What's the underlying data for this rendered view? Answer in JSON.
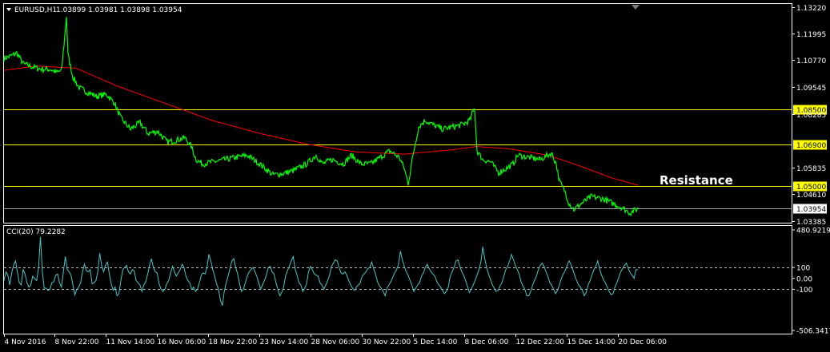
{
  "header": {
    "symbol": "EURUSD,H1",
    "ohlc": "1.03899 1.03981 1.03898 1.03954"
  },
  "colors": {
    "background": "#000000",
    "price": "#00ff00",
    "ma": "#ff0000",
    "level": "#ffff00",
    "bid": "#9aa0a6",
    "cci": "#49c6c6",
    "axis": "#ffffff"
  },
  "resistance_label": "Resistance",
  "indicator_label": "CCI(20) 79.2282",
  "chart_data": [
    {
      "type": "line",
      "title": "EURUSD,H1",
      "ylim": [
        1.033,
        1.1335
      ],
      "y_ticks": [
        "1.13220",
        "1.11995",
        "1.10770",
        "1.09545",
        "1.08285",
        "1.05835",
        "1.04610",
        "1.03385"
      ],
      "x_ticks": [
        "4 Nov 2016",
        "8 Nov 22:00",
        "11 Nov 14:00",
        "16 Nov 06:00",
        "18 Nov 22:00",
        "23 Nov 14:00",
        "28 Nov 06:00",
        "30 Nov 22:00",
        "5 Dec 14:00",
        "8 Dec 06:00",
        "12 Dec 22:00",
        "15 Dec 14:00",
        "20 Dec 06:00"
      ],
      "price_anchors": [
        [
          0,
          1.1085
        ],
        [
          8,
          1.1095
        ],
        [
          16,
          1.111
        ],
        [
          24,
          1.106
        ],
        [
          36,
          1.1045
        ],
        [
          48,
          1.1035
        ],
        [
          58,
          1.1035
        ],
        [
          66,
          1.102
        ],
        [
          72,
          1.103
        ],
        [
          75,
          1.115
        ],
        [
          78,
          1.128
        ],
        [
          80,
          1.11
        ],
        [
          86,
          1.1
        ],
        [
          94,
          1.095
        ],
        [
          104,
          1.093
        ],
        [
          116,
          1.091
        ],
        [
          128,
          1.092
        ],
        [
          138,
          1.088
        ],
        [
          146,
          1.081
        ],
        [
          158,
          1.076
        ],
        [
          170,
          1.079
        ],
        [
          180,
          1.074
        ],
        [
          192,
          1.075
        ],
        [
          204,
          1.07
        ],
        [
          216,
          1.071
        ],
        [
          226,
          1.072
        ],
        [
          234,
          1.068
        ],
        [
          240,
          1.062
        ],
        [
          248,
          1.06
        ],
        [
          262,
          1.061
        ],
        [
          276,
          1.062
        ],
        [
          290,
          1.063
        ],
        [
          304,
          1.064
        ],
        [
          316,
          1.061
        ],
        [
          326,
          1.058
        ],
        [
          336,
          1.055
        ],
        [
          348,
          1.0555
        ],
        [
          362,
          1.057
        ],
        [
          378,
          1.06
        ],
        [
          390,
          1.064
        ],
        [
          398,
          1.06
        ],
        [
          410,
          1.062
        ],
        [
          424,
          1.06
        ],
        [
          434,
          1.064
        ],
        [
          446,
          1.06
        ],
        [
          458,
          1.06
        ],
        [
          470,
          1.063
        ],
        [
          482,
          1.066
        ],
        [
          494,
          1.063
        ],
        [
          500,
          1.058
        ],
        [
          505,
          1.051
        ],
        [
          512,
          1.066
        ],
        [
          518,
          1.077
        ],
        [
          526,
          1.08
        ],
        [
          536,
          1.078
        ],
        [
          548,
          1.076
        ],
        [
          560,
          1.077
        ],
        [
          572,
          1.078
        ],
        [
          582,
          1.08
        ],
        [
          588,
          1.086
        ],
        [
          591,
          1.066
        ],
        [
          598,
          1.062
        ],
        [
          608,
          1.061
        ],
        [
          618,
          1.056
        ],
        [
          628,
          1.058
        ],
        [
          636,
          1.06
        ],
        [
          642,
          1.064
        ],
        [
          656,
          1.063
        ],
        [
          670,
          1.062
        ],
        [
          684,
          1.065
        ],
        [
          690,
          1.06
        ],
        [
          694,
          1.052
        ],
        [
          700,
          1.048
        ],
        [
          706,
          1.042
        ],
        [
          712,
          1.039
        ],
        [
          722,
          1.042
        ],
        [
          734,
          1.045
        ],
        [
          748,
          1.044
        ],
        [
          760,
          1.042
        ],
        [
          772,
          1.04
        ],
        [
          782,
          1.0375
        ],
        [
          792,
          1.0395
        ]
      ],
      "ma_anchors": [
        [
          0,
          1.103
        ],
        [
          40,
          1.105
        ],
        [
          90,
          1.104
        ],
        [
          140,
          1.096
        ],
        [
          200,
          1.088
        ],
        [
          260,
          1.08
        ],
        [
          320,
          1.074
        ],
        [
          380,
          1.069
        ],
        [
          440,
          1.0655
        ],
        [
          500,
          1.0645
        ],
        [
          560,
          1.0665
        ],
        [
          590,
          1.068
        ],
        [
          630,
          1.067
        ],
        [
          680,
          1.064
        ],
        [
          720,
          1.059
        ],
        [
          760,
          1.0535
        ],
        [
          792,
          1.0502
        ]
      ],
      "levels": [
        1.085,
        1.069,
        1.05
      ],
      "level_labels": [
        "1.08500",
        "1.06900",
        "1.05000"
      ],
      "bid": 1.03954,
      "bid_label": "1.03954"
    },
    {
      "type": "line",
      "title": "CCI(20) 79.2282",
      "ylim": [
        -506.3417,
        480.9219
      ],
      "y_ticks": [
        "480.9219",
        "100",
        "0.00",
        "-100",
        "-506.3417"
      ],
      "levels": [
        100,
        -100
      ],
      "cci_series": [
        -20,
        60,
        30,
        -60,
        50,
        120,
        160,
        60,
        -40,
        -60,
        80,
        40,
        -40,
        -80,
        -60,
        20,
        0,
        -20,
        90,
        380,
        60,
        -90,
        -90,
        -110,
        -100,
        -40,
        -30,
        30,
        40,
        -40,
        -80,
        60,
        200,
        80,
        60,
        30,
        -60,
        -150,
        -100,
        -80,
        -40,
        60,
        130,
        70,
        60,
        80,
        -50,
        -40,
        -20,
        60,
        230,
        120,
        60,
        120,
        150,
        40,
        -50,
        -110,
        -80,
        -160,
        -140,
        -20,
        80,
        100,
        120,
        60,
        40,
        80,
        70,
        -20,
        -40,
        -60,
        -120,
        -60,
        -30,
        40,
        120,
        180,
        100,
        60,
        50,
        -50,
        -100,
        -120,
        -100,
        -50,
        -20,
        50,
        110,
        60,
        20,
        50,
        80,
        130,
        100,
        20,
        -20,
        -40,
        -100,
        -80,
        -120,
        -100,
        -40,
        30,
        50,
        40,
        100,
        220,
        160,
        80,
        20,
        -50,
        -100,
        -200,
        -250,
        -120,
        -40,
        20,
        90,
        160,
        180,
        100,
        40,
        -50,
        -120,
        -100,
        -40,
        20,
        60,
        80,
        100,
        60,
        20,
        -40,
        -100,
        -60,
        -20,
        30,
        100,
        110,
        60,
        40,
        -40,
        -100,
        -160,
        -130,
        -80,
        20,
        70,
        110,
        160,
        200,
        90,
        30,
        -40,
        -60,
        -120,
        -90,
        -50,
        60,
        110,
        80,
        40,
        30,
        20,
        -40,
        -60,
        -100,
        -60,
        -20,
        30,
        110,
        140,
        170,
        160,
        100,
        50,
        40,
        60,
        30,
        -20,
        -60,
        -90,
        -110,
        -80,
        -60,
        -40,
        20,
        40,
        60,
        90,
        100,
        150,
        90,
        40,
        -30,
        -70,
        -90,
        -120,
        -160,
        -90,
        -60,
        -30,
        10,
        50,
        80,
        130,
        250,
        170,
        110,
        60,
        30,
        -20,
        -60,
        -120,
        -90,
        -60,
        -40,
        20,
        50,
        100,
        130,
        90,
        60,
        40,
        20,
        -30,
        -60,
        -80,
        -110,
        -140,
        -120,
        -80,
        20,
        60,
        100,
        160,
        170,
        110,
        60,
        30,
        -20,
        -70,
        -130,
        -100,
        -60,
        -20,
        30,
        80,
        150,
        290,
        180,
        100,
        40,
        -10,
        -60,
        -90,
        -120,
        -110,
        -70,
        -40,
        20,
        80,
        110,
        160,
        220,
        170,
        120,
        80,
        40,
        -30,
        -70,
        -100,
        -160,
        -160,
        -120,
        -60,
        -20,
        20,
        80,
        120,
        140,
        110,
        60,
        20,
        -40,
        -60,
        -100,
        -140,
        -110,
        -60,
        0,
        40,
        70,
        120,
        160,
        130,
        80,
        30,
        -20,
        -60,
        -80,
        -110,
        -160,
        -130,
        -60,
        -20,
        30,
        80,
        110,
        160,
        90,
        30,
        -10,
        -40,
        -80,
        -120,
        -150,
        -140,
        -80,
        -40,
        10,
        60,
        90,
        120,
        140,
        90,
        50,
        30,
        0,
        80,
        79
      ]
    }
  ]
}
